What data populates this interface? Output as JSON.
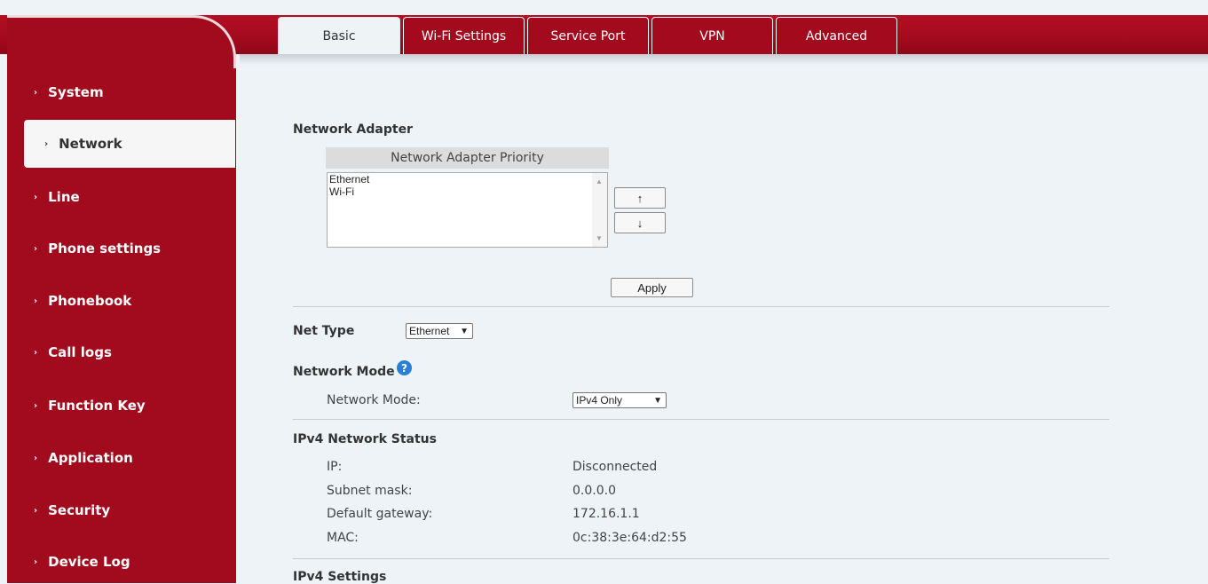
{
  "sidebar": {
    "items": [
      {
        "label": "System"
      },
      {
        "label": "Network",
        "active": true
      },
      {
        "label": "Line"
      },
      {
        "label": "Phone settings"
      },
      {
        "label": "Phonebook"
      },
      {
        "label": "Call logs"
      },
      {
        "label": "Function Key"
      },
      {
        "label": "Application"
      },
      {
        "label": "Security"
      },
      {
        "label": "Device Log"
      }
    ],
    "chevron": "›"
  },
  "tabs": [
    {
      "label": "Basic",
      "active": true
    },
    {
      "label": "Wi-Fi Settings"
    },
    {
      "label": "Service Port"
    },
    {
      "label": "VPN"
    },
    {
      "label": "Advanced"
    }
  ],
  "network_adapter": {
    "title": "Network Adapter",
    "priority_header": "Network Adapter Priority",
    "options": [
      "Ethernet",
      "Wi-Fi"
    ],
    "up_label": "↑",
    "down_label": "↓",
    "apply_label": "Apply"
  },
  "net_type": {
    "label": "Net Type",
    "selected": "Ethernet"
  },
  "network_mode": {
    "title": "Network Mode",
    "label": "Network Mode:",
    "selected": "IPv4 Only",
    "help_icon": "question-circle-icon"
  },
  "ipv4_status": {
    "title": "IPv4 Network Status",
    "rows": [
      {
        "label": "IP:",
        "value": "Disconnected"
      },
      {
        "label": "Subnet mask:",
        "value": "0.0.0.0"
      },
      {
        "label": "Default gateway:",
        "value": "172.16.1.1"
      },
      {
        "label": "MAC:",
        "value": "0c:38:3e:64:d2:55"
      }
    ]
  },
  "ipv4_settings": {
    "title": "IPv4 Settings"
  },
  "colors": {
    "brand_red": "#a20b1e",
    "background": "#edf3f7",
    "help_blue": "#2b7fd4"
  }
}
